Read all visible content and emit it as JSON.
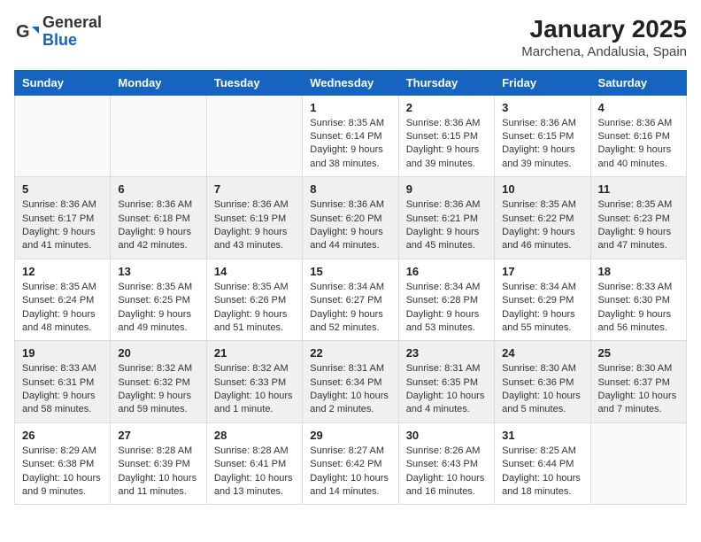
{
  "logo": {
    "general": "General",
    "blue": "Blue"
  },
  "title": "January 2025",
  "subtitle": "Marchena, Andalusia, Spain",
  "weekdays": [
    "Sunday",
    "Monday",
    "Tuesday",
    "Wednesday",
    "Thursday",
    "Friday",
    "Saturday"
  ],
  "weeks": [
    [
      {
        "day": "",
        "info": ""
      },
      {
        "day": "",
        "info": ""
      },
      {
        "day": "",
        "info": ""
      },
      {
        "day": "1",
        "info": "Sunrise: 8:35 AM\nSunset: 6:14 PM\nDaylight: 9 hours\nand 38 minutes."
      },
      {
        "day": "2",
        "info": "Sunrise: 8:36 AM\nSunset: 6:15 PM\nDaylight: 9 hours\nand 39 minutes."
      },
      {
        "day": "3",
        "info": "Sunrise: 8:36 AM\nSunset: 6:15 PM\nDaylight: 9 hours\nand 39 minutes."
      },
      {
        "day": "4",
        "info": "Sunrise: 8:36 AM\nSunset: 6:16 PM\nDaylight: 9 hours\nand 40 minutes."
      }
    ],
    [
      {
        "day": "5",
        "info": "Sunrise: 8:36 AM\nSunset: 6:17 PM\nDaylight: 9 hours\nand 41 minutes."
      },
      {
        "day": "6",
        "info": "Sunrise: 8:36 AM\nSunset: 6:18 PM\nDaylight: 9 hours\nand 42 minutes."
      },
      {
        "day": "7",
        "info": "Sunrise: 8:36 AM\nSunset: 6:19 PM\nDaylight: 9 hours\nand 43 minutes."
      },
      {
        "day": "8",
        "info": "Sunrise: 8:36 AM\nSunset: 6:20 PM\nDaylight: 9 hours\nand 44 minutes."
      },
      {
        "day": "9",
        "info": "Sunrise: 8:36 AM\nSunset: 6:21 PM\nDaylight: 9 hours\nand 45 minutes."
      },
      {
        "day": "10",
        "info": "Sunrise: 8:35 AM\nSunset: 6:22 PM\nDaylight: 9 hours\nand 46 minutes."
      },
      {
        "day": "11",
        "info": "Sunrise: 8:35 AM\nSunset: 6:23 PM\nDaylight: 9 hours\nand 47 minutes."
      }
    ],
    [
      {
        "day": "12",
        "info": "Sunrise: 8:35 AM\nSunset: 6:24 PM\nDaylight: 9 hours\nand 48 minutes."
      },
      {
        "day": "13",
        "info": "Sunrise: 8:35 AM\nSunset: 6:25 PM\nDaylight: 9 hours\nand 49 minutes."
      },
      {
        "day": "14",
        "info": "Sunrise: 8:35 AM\nSunset: 6:26 PM\nDaylight: 9 hours\nand 51 minutes."
      },
      {
        "day": "15",
        "info": "Sunrise: 8:34 AM\nSunset: 6:27 PM\nDaylight: 9 hours\nand 52 minutes."
      },
      {
        "day": "16",
        "info": "Sunrise: 8:34 AM\nSunset: 6:28 PM\nDaylight: 9 hours\nand 53 minutes."
      },
      {
        "day": "17",
        "info": "Sunrise: 8:34 AM\nSunset: 6:29 PM\nDaylight: 9 hours\nand 55 minutes."
      },
      {
        "day": "18",
        "info": "Sunrise: 8:33 AM\nSunset: 6:30 PM\nDaylight: 9 hours\nand 56 minutes."
      }
    ],
    [
      {
        "day": "19",
        "info": "Sunrise: 8:33 AM\nSunset: 6:31 PM\nDaylight: 9 hours\nand 58 minutes."
      },
      {
        "day": "20",
        "info": "Sunrise: 8:32 AM\nSunset: 6:32 PM\nDaylight: 9 hours\nand 59 minutes."
      },
      {
        "day": "21",
        "info": "Sunrise: 8:32 AM\nSunset: 6:33 PM\nDaylight: 10 hours\nand 1 minute."
      },
      {
        "day": "22",
        "info": "Sunrise: 8:31 AM\nSunset: 6:34 PM\nDaylight: 10 hours\nand 2 minutes."
      },
      {
        "day": "23",
        "info": "Sunrise: 8:31 AM\nSunset: 6:35 PM\nDaylight: 10 hours\nand 4 minutes."
      },
      {
        "day": "24",
        "info": "Sunrise: 8:30 AM\nSunset: 6:36 PM\nDaylight: 10 hours\nand 5 minutes."
      },
      {
        "day": "25",
        "info": "Sunrise: 8:30 AM\nSunset: 6:37 PM\nDaylight: 10 hours\nand 7 minutes."
      }
    ],
    [
      {
        "day": "26",
        "info": "Sunrise: 8:29 AM\nSunset: 6:38 PM\nDaylight: 10 hours\nand 9 minutes."
      },
      {
        "day": "27",
        "info": "Sunrise: 8:28 AM\nSunset: 6:39 PM\nDaylight: 10 hours\nand 11 minutes."
      },
      {
        "day": "28",
        "info": "Sunrise: 8:28 AM\nSunset: 6:41 PM\nDaylight: 10 hours\nand 13 minutes."
      },
      {
        "day": "29",
        "info": "Sunrise: 8:27 AM\nSunset: 6:42 PM\nDaylight: 10 hours\nand 14 minutes."
      },
      {
        "day": "30",
        "info": "Sunrise: 8:26 AM\nSunset: 6:43 PM\nDaylight: 10 hours\nand 16 minutes."
      },
      {
        "day": "31",
        "info": "Sunrise: 8:25 AM\nSunset: 6:44 PM\nDaylight: 10 hours\nand 18 minutes."
      },
      {
        "day": "",
        "info": ""
      }
    ]
  ]
}
